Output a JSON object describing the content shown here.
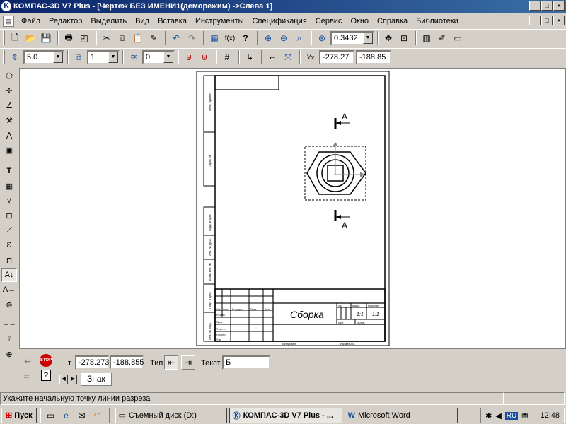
{
  "window": {
    "title": "КОМПАС-3D V7 Plus - [Чертеж БЕЗ ИМЕНИ1(деморежим) ->Слева 1]",
    "min": "_",
    "max": "□",
    "close": "×"
  },
  "menu": {
    "items": [
      "Файл",
      "Редактор",
      "Выделить",
      "Вид",
      "Вставка",
      "Инструменты",
      "Спецификация",
      "Сервис",
      "Окно",
      "Справка",
      "Библиотеки"
    ]
  },
  "toolbar1": {
    "zoom_value": "0.3432",
    "icons": [
      "new-icon",
      "open-icon",
      "save-icon",
      "print-icon",
      "preview-icon",
      "cut-icon",
      "copy-icon",
      "paste-icon",
      "format-icon",
      "undo-icon",
      "redo-icon",
      "variables-icon",
      "function-icon",
      "help-icon",
      "zoom-in-icon",
      "zoom-out-icon",
      "zoom-window-icon",
      "zoom-scale-icon",
      "pan-icon",
      "fit-icon",
      "library-icon",
      "manager-icon",
      "layout-icon"
    ]
  },
  "toolbar2": {
    "step_value": "5.0",
    "layer_value": "1",
    "style_value": "0",
    "x_coord": "-278.27",
    "y_coord": "-188.85"
  },
  "drawing": {
    "view_label_top": "A",
    "view_label_bottom": "A",
    "title_block_name": "Сборка",
    "title_lit": "Лит.",
    "title_mass": "Масса",
    "title_scale": "Масштаб",
    "title_val1": "1:1",
    "title_val2": "1:1",
    "title_sheet": "Лист",
    "title_sheets": "Листов",
    "copied_label": "Копировал",
    "format_label": "Формат А4",
    "frame_labels": [
      "Перв. примен.",
      "Справ. №",
      "Подп. и дата",
      "Инв. № дубл.",
      "Взам. инв. №",
      "Подп. и дата",
      "Инв. № подл."
    ],
    "block_labels": [
      "Изм.",
      "Лист",
      "№ докум.",
      "Подп.",
      "Дата",
      "Разраб.",
      "Пров.",
      "Т.контр.",
      "Н.контр.",
      "Утв."
    ]
  },
  "props": {
    "t_label": "т",
    "x_value": "-278.273",
    "y_value": "-188.855",
    "type_label": "Тип",
    "text_label": "Текст",
    "text_value": "Б",
    "tab_label": "Знак"
  },
  "status": {
    "message": "Укажите начальную точку линии разреза"
  },
  "taskbar": {
    "start": "Пуск",
    "tasks": [
      {
        "label": "Съемный диск (D:)",
        "active": false
      },
      {
        "label": "КОМПАС-3D V7 Plus - ...",
        "active": true
      },
      {
        "label": "Microsoft Word",
        "active": false
      }
    ],
    "lang": "RU",
    "clock": "12:48"
  },
  "colors": {
    "titlebar": "#0a246a",
    "face": "#d4d0c8",
    "stop": "#cc0000"
  }
}
